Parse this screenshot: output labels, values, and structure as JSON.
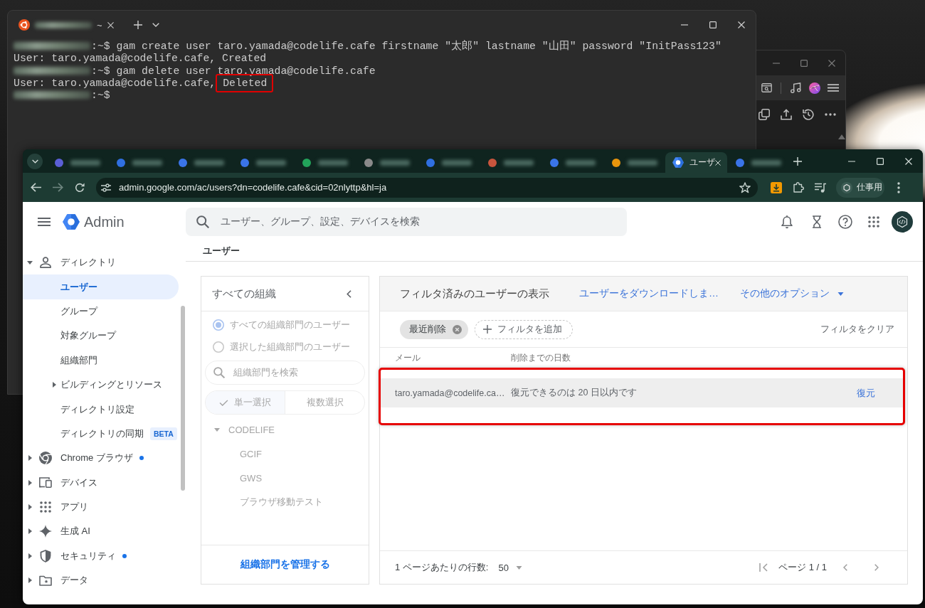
{
  "terminal": {
    "tab": {
      "title": "~",
      "redacted": true
    },
    "lines": [
      {
        "kind": "command",
        "text": ":~$ gam create user taro.yamada@codelife.cafe firstname \"太郎\" lastname \"山田\" password \"InitPass123\""
      },
      {
        "kind": "output",
        "text": "User: taro.yamada@codelife.cafe, Created"
      },
      {
        "kind": "command",
        "text": ":~$ gam delete user taro.yamada@codelife.cafe"
      },
      {
        "kind": "output",
        "text": "User: taro.yamada@codelife.cafe,",
        "annotated_text": "Deleted"
      },
      {
        "kind": "command",
        "text": ":~$"
      }
    ]
  },
  "browser": {
    "tabs": [
      {
        "kind": "redacted",
        "color": "#5b5fd6",
        "selected": false
      },
      {
        "kind": "redacted",
        "color": "#2f6fe0",
        "selected": false
      },
      {
        "kind": "redacted",
        "color": "#3a74e8",
        "selected": false
      },
      {
        "kind": "redacted",
        "color": "#3a74e8",
        "selected": false
      },
      {
        "kind": "redacted",
        "color": "#22a35a",
        "selected": false
      },
      {
        "kind": "redacted",
        "color": "#8a8a8a",
        "selected": false
      },
      {
        "kind": "redacted",
        "color": "#2f6fe0",
        "selected": false
      },
      {
        "kind": "redacted",
        "color": "#c8553d",
        "selected": false
      },
      {
        "kind": "redacted",
        "color": "#3a74e8",
        "selected": false
      },
      {
        "kind": "redacted",
        "color": "#e8950c",
        "selected": false
      },
      {
        "kind": "page",
        "label": "ユーザ",
        "selected": true
      },
      {
        "kind": "redacted",
        "color": "#3a74e8",
        "selected": false
      }
    ],
    "url": "admin.google.com/ac/users?dn=codelife.cafe&cid=02nlyttp&hl=ja",
    "profile": "仕事用"
  },
  "admin": {
    "app_name": "Admin",
    "search": {
      "placeholder": "ユーザー、グループ、設定、デバイスを検索"
    },
    "page_title": "ユーザー",
    "sidebar": {
      "items": [
        {
          "kind": "group",
          "label": "ディレクトリ",
          "expanded": true,
          "selected": false,
          "dot": false,
          "children": [
            {
              "kind": "page",
              "label": "ユーザー",
              "selected": true
            },
            {
              "kind": "page",
              "label": "グループ",
              "selected": false
            },
            {
              "kind": "page",
              "label": "対象グループ",
              "selected": false
            },
            {
              "kind": "page",
              "label": "組織部門",
              "selected": false
            },
            {
              "kind": "group",
              "label": "ビルディングとリソース",
              "expanded": false,
              "selected": false
            },
            {
              "kind": "page",
              "label": "ディレクトリ設定",
              "selected": false
            },
            {
              "kind": "page",
              "label": "ディレクトリの同期",
              "badge": "BETA",
              "selected": false
            }
          ]
        },
        {
          "kind": "group",
          "label": "Chrome ブラウザ",
          "expanded": false,
          "selected": false,
          "dot": true
        },
        {
          "kind": "group",
          "label": "デバイス",
          "expanded": false,
          "selected": false,
          "dot": false
        },
        {
          "kind": "group",
          "label": "アプリ",
          "expanded": false,
          "selected": false,
          "dot": false
        },
        {
          "kind": "group",
          "label": "生成 AI",
          "expanded": false,
          "selected": false,
          "dot": false
        },
        {
          "kind": "group",
          "label": "セキュリティ",
          "expanded": false,
          "selected": false,
          "dot": true
        },
        {
          "kind": "group",
          "label": "データ",
          "expanded": false,
          "selected": false,
          "dot": false
        }
      ]
    },
    "org_panel": {
      "title": "すべての組織",
      "disabled": true,
      "scope_options": [
        {
          "label": "すべての組織部門のユーザー",
          "selected": true
        },
        {
          "label": "選択した組織部門のユーザー",
          "selected": false
        }
      ],
      "search": {
        "placeholder": "組織部門を検索"
      },
      "modes": [
        {
          "label": "単一選択",
          "selected": true
        },
        {
          "label": "複数選択",
          "selected": false
        }
      ],
      "tree": [
        {
          "label": "CODELIFE",
          "expanded": true,
          "children": [
            {
              "label": "GCIF"
            },
            {
              "label": "GWS"
            },
            {
              "label": "ブラウザ移動テスト"
            }
          ]
        }
      ],
      "manage_link": "組織部門を管理する"
    },
    "users_panel": {
      "title": "フィルタ済みのユーザーの表示",
      "actions": [
        {
          "kind": "link",
          "label": "ユーザーをダウンロードしま…"
        },
        {
          "kind": "menu",
          "label": "その他のオプション"
        }
      ],
      "filters": [
        {
          "label": "最近削除"
        }
      ],
      "add_filter": "フィルタを追加",
      "clear_filters": "フィルタをクリア",
      "table": {
        "columns": [
          "メール",
          "削除までの日数"
        ],
        "rows": [
          {
            "cells": [
              "taro.yamada@codelife.ca…",
              "復元できるのは 20 日以内です"
            ],
            "action": "復元",
            "hovered": true,
            "annotated": true
          }
        ]
      },
      "footer": {
        "rows_per_page_label": "1 ページあたりの行数:",
        "rows_per_page": "50",
        "page": "ページ 1 / 1"
      }
    }
  }
}
